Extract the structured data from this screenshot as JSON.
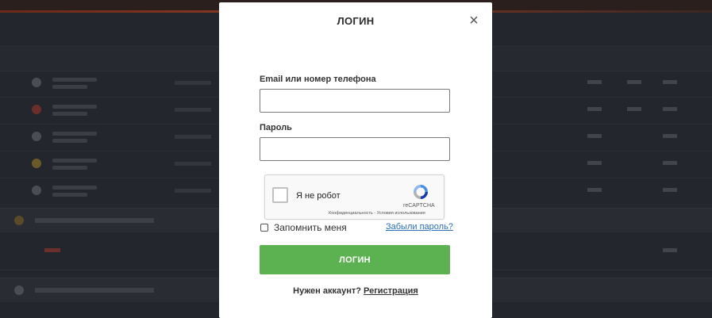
{
  "modal": {
    "title": "ЛОГИН",
    "close_icon": "×",
    "email": {
      "label": "Email или номер телефона",
      "value": "",
      "placeholder": ""
    },
    "password": {
      "label": "Пароль",
      "value": "",
      "placeholder": ""
    },
    "recaptcha": {
      "label": "Я не робот",
      "brand": "reCAPTCHA",
      "terms": "Конфиденциальность - Условия использования"
    },
    "remember": {
      "label": "Запомнить меня",
      "checked": false
    },
    "forgot_link": "Забыли пароль?",
    "login_button": "ЛОГИН",
    "footer": {
      "question": "Нужен аккаунт?",
      "register_link": "Регистрация"
    }
  },
  "colors": {
    "overlay_bg": "#23262d",
    "primary_button": "#5cb251",
    "link": "#2a6fb8"
  }
}
